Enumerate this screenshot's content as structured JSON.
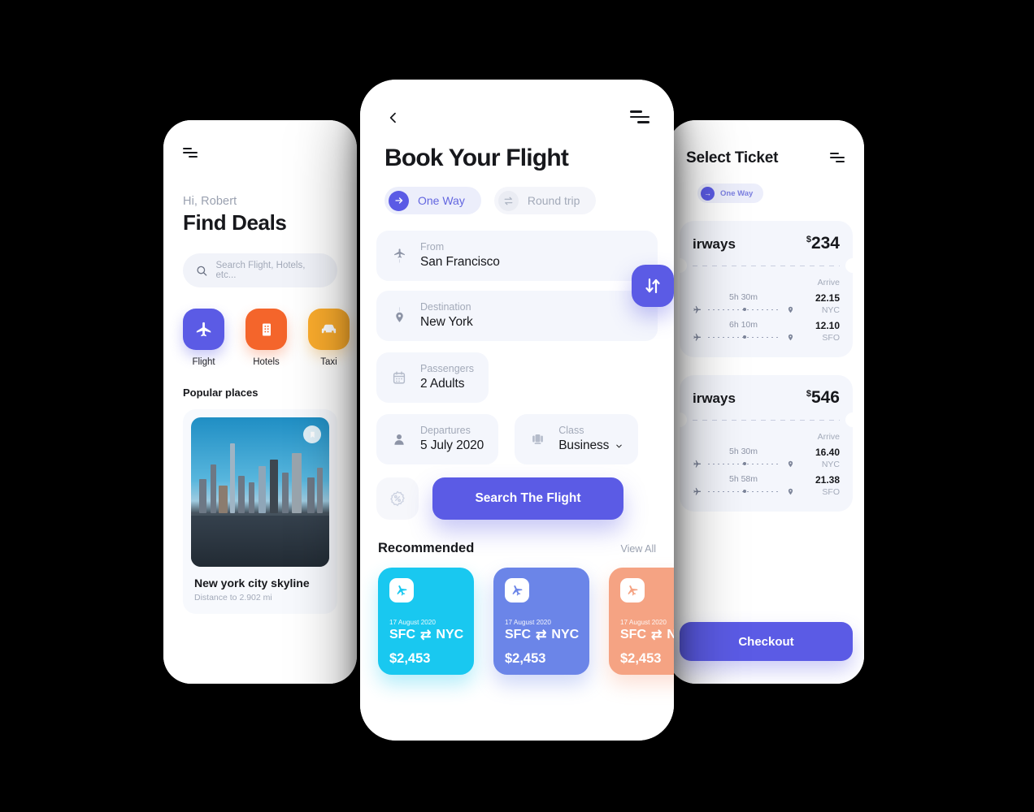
{
  "left_screen": {
    "menu_icon": "hamburger-menu-icon",
    "greeting": "Hi, Robert",
    "title": "Find Deals",
    "search": {
      "placeholder": "Search Flight, Hotels, etc...",
      "icon": "search-icon"
    },
    "categories": [
      {
        "label": "Flight",
        "icon": "airplane-icon",
        "color": "#5B5BE5"
      },
      {
        "label": "Hotels",
        "icon": "building-icon",
        "color": "#F4652B"
      },
      {
        "label": "Taxi",
        "icon": "car-icon",
        "color": "#FBAC2C"
      }
    ],
    "section_title": "Popular places",
    "place": {
      "name": "New york city skyline",
      "distance": "Distance to 2.902 mi",
      "bookmark_icon": "bookmark-icon"
    }
  },
  "center_screen": {
    "back_icon": "chevron-left-icon",
    "menu_icon": "hamburger-menu-icon",
    "title": "Book Your Flight",
    "trip_types": [
      {
        "label": "One Way",
        "icon": "arrow-right-icon",
        "active": true
      },
      {
        "label": "Round trip",
        "icon": "swap-horizontal-icon",
        "active": false
      }
    ],
    "fields": {
      "from": {
        "label": "From",
        "value": "San Francisco",
        "icon": "airplane-takeoff-icon"
      },
      "destination": {
        "label": "Destination",
        "value": "New York",
        "icon": "location-pin-icon"
      },
      "passengers": {
        "label": "Passengers",
        "value": "2 Adults",
        "icon": "calendar-icon"
      },
      "departures": {
        "label": "Departures",
        "value": "5 July 2020",
        "icon": "person-icon"
      },
      "class": {
        "label": "Class",
        "value": "Business",
        "icon": "seat-icon",
        "chevron": "chevron-down-icon"
      }
    },
    "swap_button_icon": "swap-vertical-icon",
    "discount_button_icon": "percent-badge-icon",
    "search_button": "Search The Flight",
    "recommended": {
      "title": "Recommended",
      "view_all": "View All",
      "cards": [
        {
          "date": "17 August 2020",
          "from": "SFC",
          "to": "NYC",
          "price": "$2,453",
          "color": "#19C8F0",
          "icon": "airplane-icon"
        },
        {
          "date": "17 August 2020",
          "from": "SFC",
          "to": "NYC",
          "price": "$2,453",
          "color": "#6B85E8",
          "icon": "airplane-icon"
        },
        {
          "date": "17 August 2020",
          "from": "SFC",
          "to": "NYC",
          "price": "$2,453",
          "color": "#F5A383",
          "icon": "airplane-icon"
        }
      ],
      "route_separator": "⇄"
    }
  },
  "right_screen": {
    "title": "Select Ticket",
    "menu_icon": "hamburger-menu-icon",
    "trip_type": {
      "label": "One Way",
      "icon": "arrow-right-icon"
    },
    "arrive_label": "Arrive",
    "tickets": [
      {
        "airline": "irways",
        "price": "234",
        "currency": "$",
        "legs": [
          {
            "duration": "5h 30m",
            "time": "22.15",
            "code": "NYC"
          },
          {
            "duration": "6h 10m",
            "time": "12.10",
            "code": "SFO"
          }
        ]
      },
      {
        "airline": "irways",
        "price": "546",
        "currency": "$",
        "legs": [
          {
            "duration": "5h 30m",
            "time": "16.40",
            "code": "NYC"
          },
          {
            "duration": "5h 58m",
            "time": "21.38",
            "code": "SFO"
          }
        ]
      }
    ],
    "checkout_button": "Checkout"
  },
  "theme": {
    "accent": "#5B5BE5",
    "background": "#000000",
    "surface": "#FFFFFF",
    "field_bg": "#F4F6FC",
    "text_primary": "#17181C",
    "text_muted": "#A3AAB9"
  }
}
